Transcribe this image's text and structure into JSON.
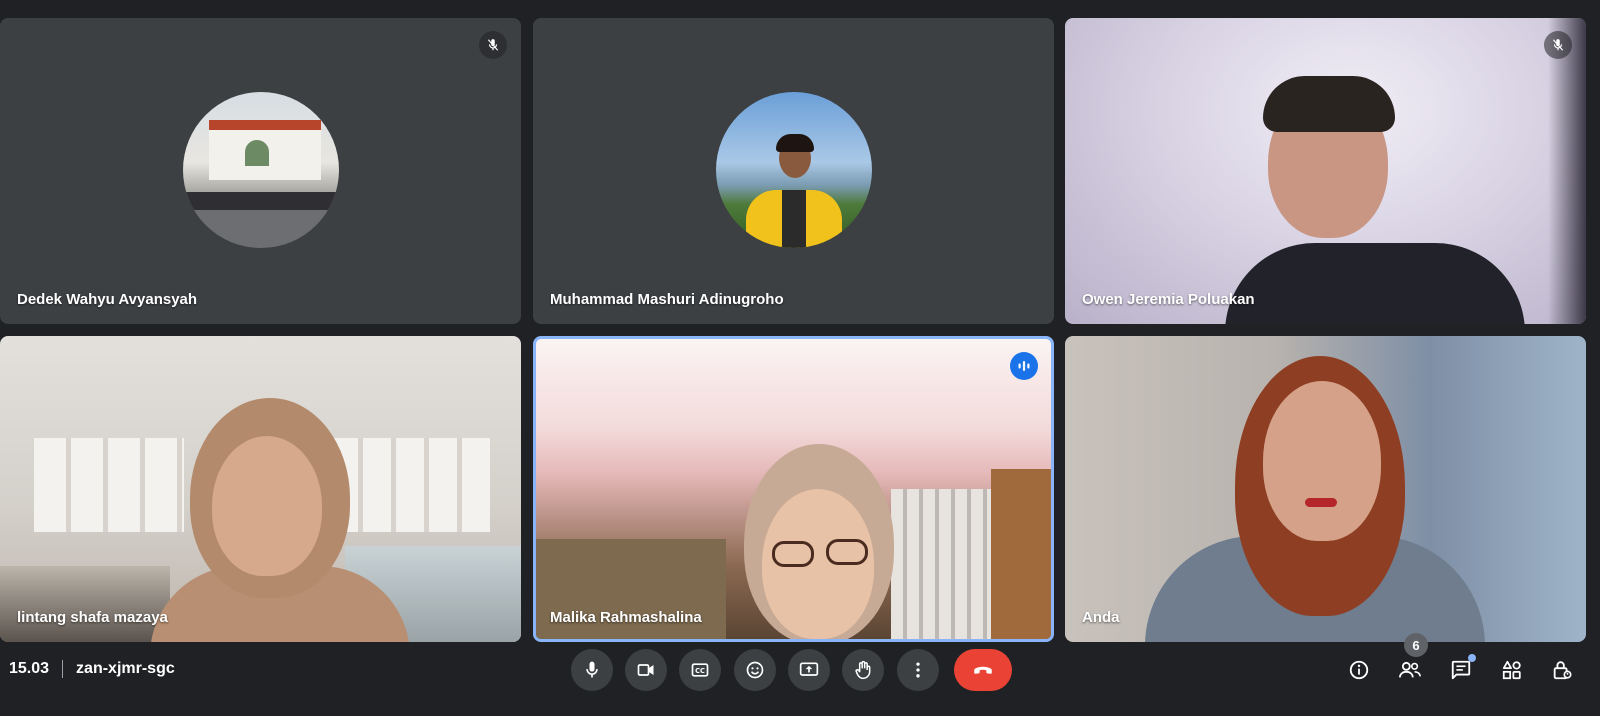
{
  "participants": [
    {
      "name": "Dedek Wahyu Avyansyah",
      "muted": true,
      "camera": "off"
    },
    {
      "name": "Muhammad Mashuri Adinugroho",
      "muted": false,
      "camera": "off"
    },
    {
      "name": "Owen Jeremia Poluakan",
      "muted": true,
      "camera": "on"
    },
    {
      "name": "lintang shafa mazaya",
      "muted": false,
      "camera": "on"
    },
    {
      "name": "Malika Rahmashalina",
      "muted": false,
      "camera": "on",
      "speaking": true
    },
    {
      "name": "Anda",
      "muted": false,
      "camera": "on"
    }
  ],
  "meeting": {
    "time": "15.03",
    "code": "zan-xjmr-sgc"
  },
  "controls": {
    "microphone": "microphone-icon",
    "camera": "video-camera-icon",
    "captions": "closed-captions-icon",
    "reactions": "emoji-icon",
    "present": "present-screen-icon",
    "raise_hand": "raise-hand-icon",
    "more": "more-options-icon",
    "leave": "end-call-icon"
  },
  "side_panel": {
    "people_count": "6"
  },
  "colors": {
    "background": "#202124",
    "tile": "#3c4043",
    "end_call": "#ea4335",
    "accent": "#8ab4f8",
    "speaking": "#1a73e8"
  }
}
